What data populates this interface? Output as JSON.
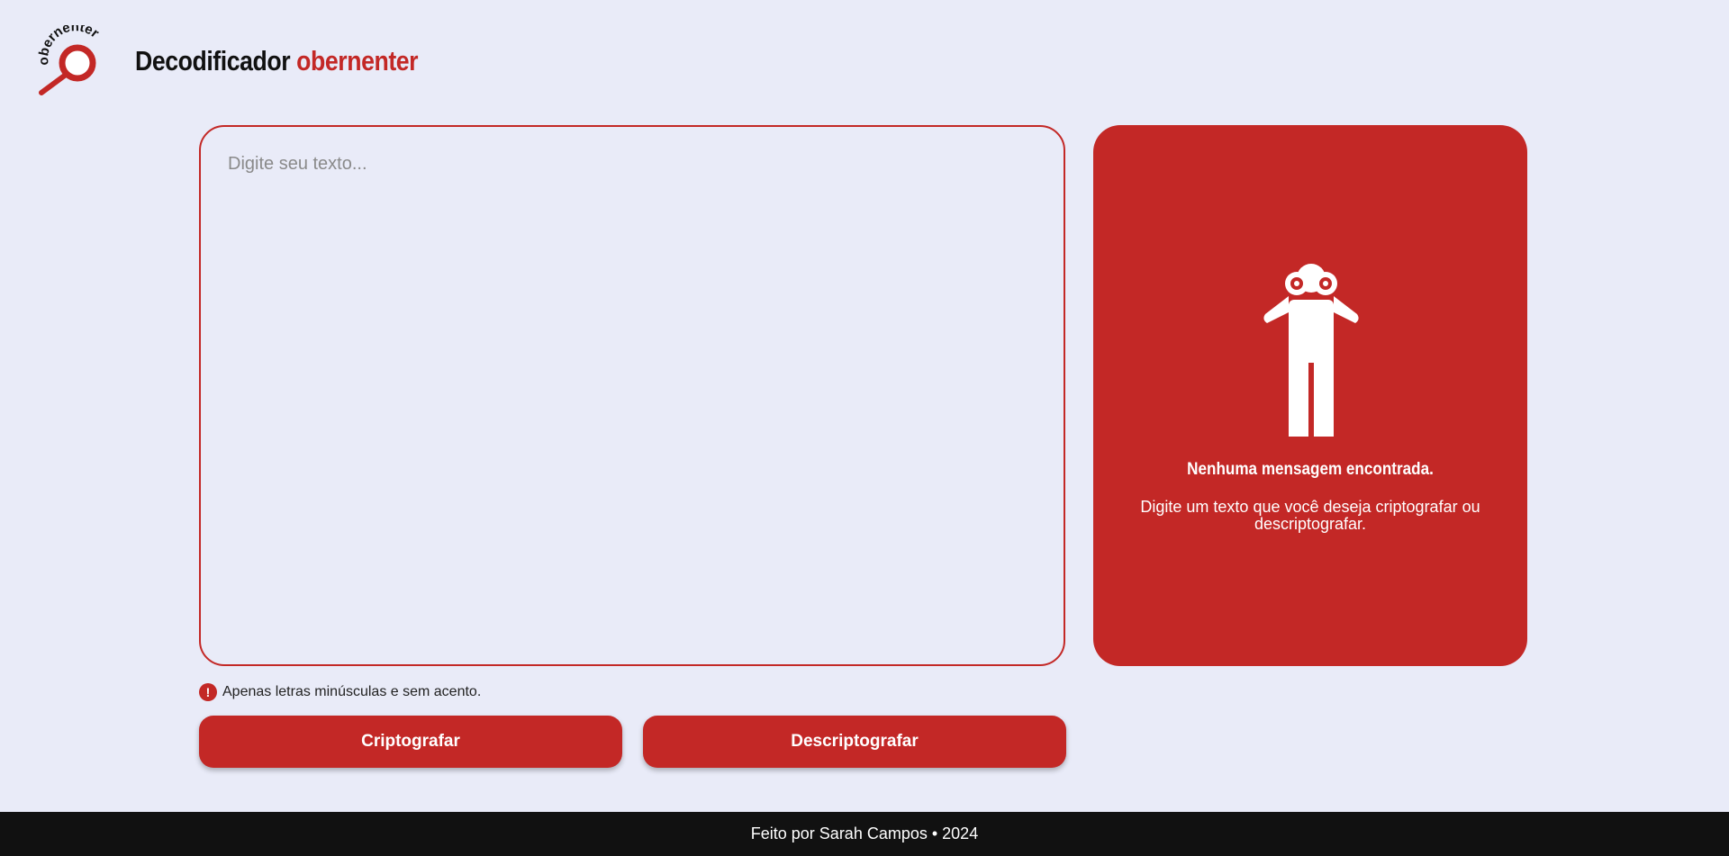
{
  "header": {
    "logo_text": "obernenter",
    "brand_prefix": "Decodificador",
    "brand_accent": "obernenter"
  },
  "input": {
    "placeholder": "Digite seu texto...",
    "value": ""
  },
  "output": {
    "icon": "binoculars-person-icon",
    "title": "Nenhuma mensagem encontrada.",
    "subtitle": "Digite um texto que você deseja criptografar ou descriptografar."
  },
  "hint": {
    "icon": "alert-icon",
    "symbol": "!",
    "text": "Apenas letras minúsculas e sem acento."
  },
  "buttons": {
    "encrypt": "Criptografar",
    "decrypt": "Descriptografar"
  },
  "footer": {
    "text": "Feito por Sarah Campos • 2024"
  },
  "colors": {
    "accent": "#c32826",
    "background": "#e9ebf8",
    "footer": "#111111"
  }
}
